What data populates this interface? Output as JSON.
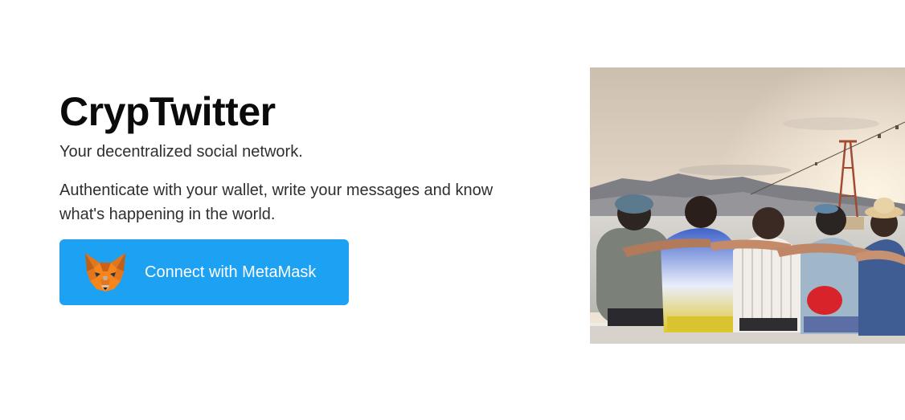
{
  "hero": {
    "title": "CrypTwitter",
    "tagline": "Your decentralized social network.",
    "description": "Authenticate with your wallet, write your messages and know what's happening in the world.",
    "connect_button": {
      "label": "Connect with MetaMask",
      "icon": "metamask-fox-icon",
      "color": "#1da1f2"
    }
  },
  "photo": {
    "alt": "Group of friends sitting on a ledge by the sea"
  }
}
